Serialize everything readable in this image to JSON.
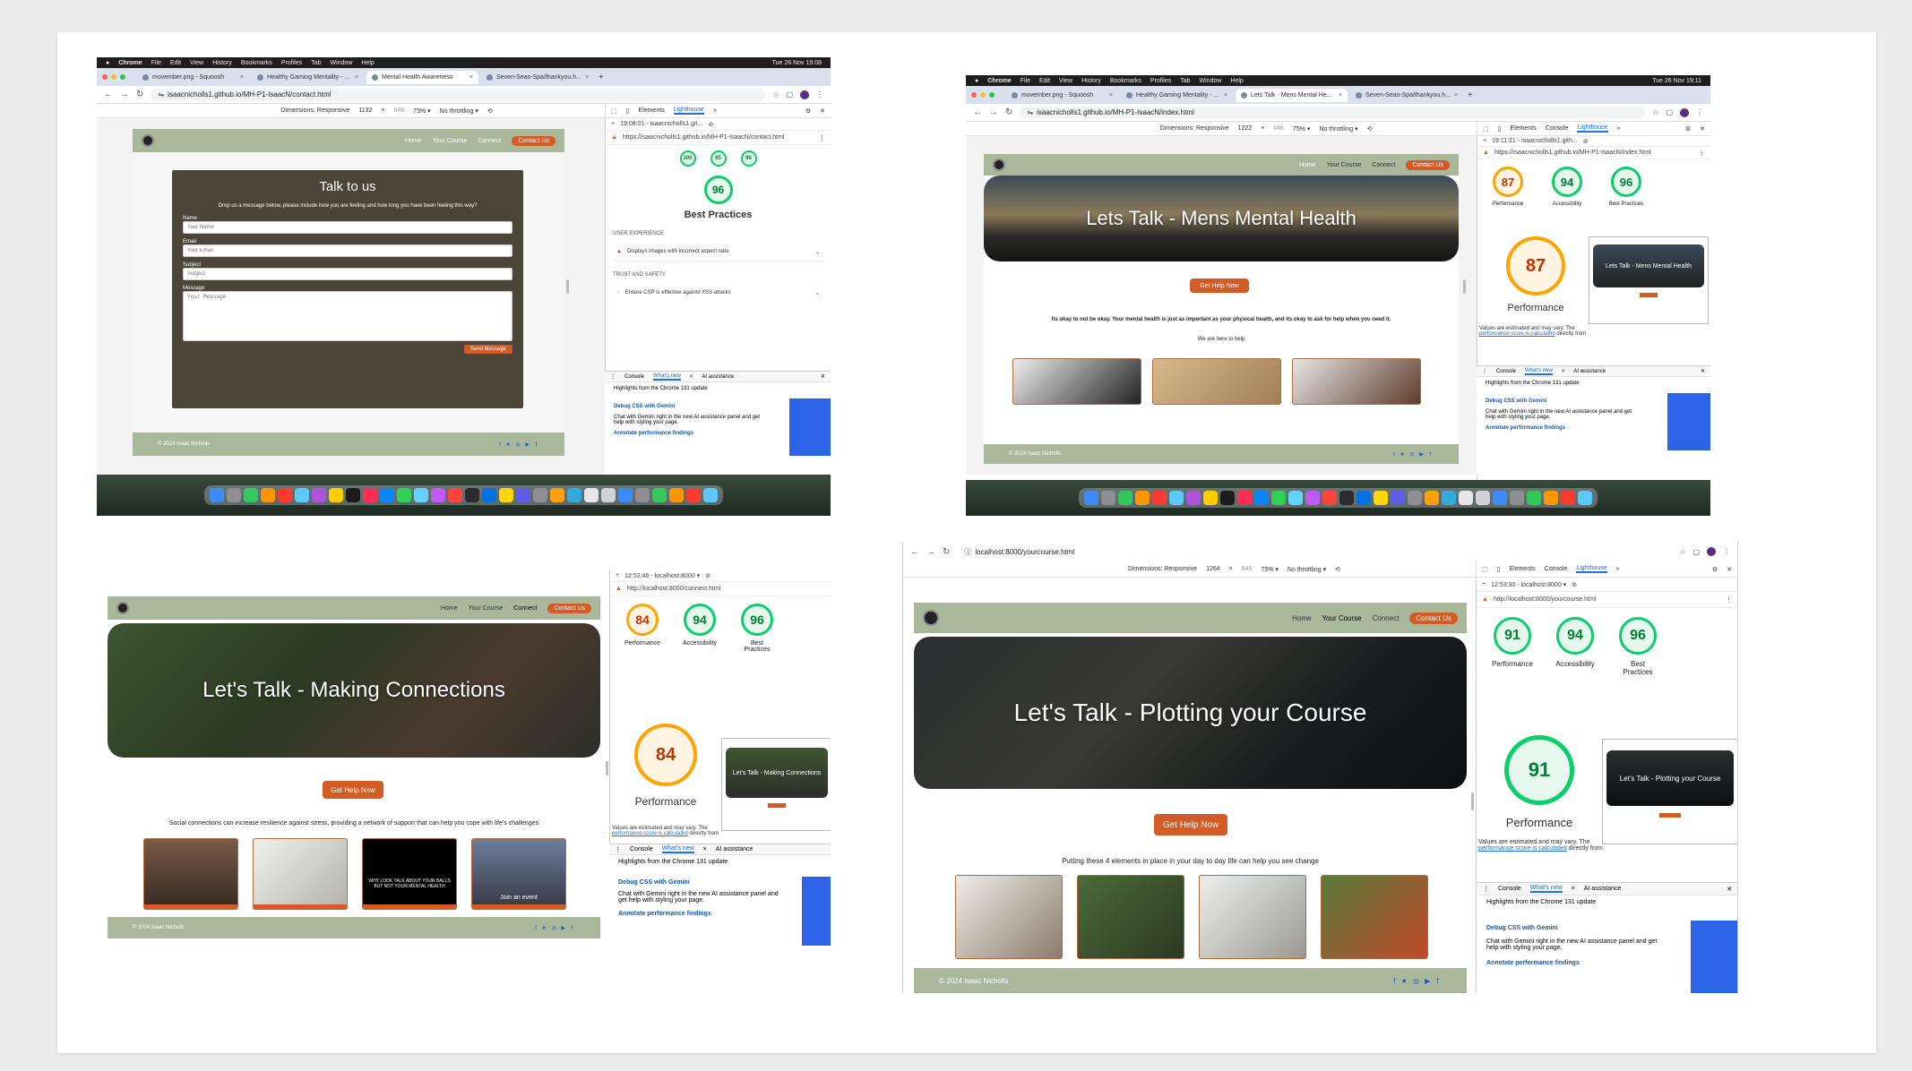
{
  "mac": {
    "apple": "",
    "app": "Chrome",
    "menus": [
      "File",
      "Edit",
      "View",
      "History",
      "Bookmarks",
      "Profiles",
      "Tab",
      "Window",
      "Help"
    ]
  },
  "shot1": {
    "clock": "Tue 26 Nov 19:08",
    "tabs": [
      "movember.png - Squoosh",
      "Healthy Gaming Mentality - ...",
      "Mental Health Awareness",
      "Seven-Seas-Spa/thankyou.h..."
    ],
    "url": "isaacnicholls1.github.io/MH-P1-IsaacN/contact.html",
    "dims": "Dimensions: Responsive",
    "w": "1132",
    "h": "646",
    "zoom": "75%",
    "throttle": "No throttling",
    "lh_time": "19:08:01 - isaacnicholls1.git...",
    "lh_url": "https://isaacnicholls1.github.io/MH-P1-IsaacN/contact.html",
    "mini_scores": [
      "100",
      "95",
      "96"
    ],
    "big_score": "96",
    "big_label": "Best Practices",
    "ux": "USER EXPERIENCE",
    "ux_item": "Displays images with incorrect aspect ratio",
    "trust": "TRUST AND SAFETY",
    "trust_item": "Ensure CSP is effective against XSS attacks",
    "form": {
      "title": "Talk to us",
      "intro": "Drop us a message below, please include how you are feeling and how long you have been feeling this way?",
      "name": "Name",
      "name_ph": "Your Name",
      "email": "Email",
      "email_ph": "Your Email",
      "subject": "Subject",
      "subject_ph": "Subject",
      "message": "Message",
      "message_ph": "Your Message",
      "send": "Send Message"
    }
  },
  "shot2": {
    "clock": "Tue 26 Nov 19:11",
    "tabs": [
      "movember.png - Squoosh",
      "Healthy Gaming Mentality - ...",
      "Lets Talk - Mens Mental He...",
      "Seven-Seas-Spa/thankyou.h..."
    ],
    "url": "isaacnicholls1.github.io/MH-P1-IsaacN/index.html",
    "w": "1222",
    "h": "646",
    "lh_time": "19:11:21 - isaacnicholls1.gith...",
    "lh_url": "https://isaacnicholls1.github.io/MH-P1-IsaacN/index.html",
    "scores": [
      {
        "v": "87",
        "l": "Performance"
      },
      {
        "v": "94",
        "l": "Accessibility"
      },
      {
        "v": "96",
        "l": "Best Practices"
      }
    ],
    "big": "87",
    "hero": "Lets Talk - Mens Mental Health",
    "tagline": "Its okay to not be okay. Your mental health is just as important as your physical health, and its okay to ask for help when you need it.",
    "sub": "We are here to help",
    "thumb": "Lets Talk - Mens Mental Health"
  },
  "shot3": {
    "lh_time": "12:52:46 - localhost:8000 ▾",
    "lh_url": "http://localhost:8000/connect.html",
    "scores": [
      {
        "v": "84",
        "l": "Performance"
      },
      {
        "v": "94",
        "l": "Accessibility"
      },
      {
        "v": "96",
        "l": "Best Practices"
      }
    ],
    "big": "84",
    "hero": "Let's Talk - Making Connections",
    "tagline": "Social connections can increase resilience against stress, providing a network of support that can help you cope with life's challenges",
    "thumb": "Let's Talk - Making Connections",
    "card3": "WHY LOOK TALK ABOUT YOUR BALLS BUT NOT YOUR MENTAL HEALTH",
    "card4": "Join an event"
  },
  "shot4": {
    "url": "localhost:8000/yourcourse.html",
    "w": "1264",
    "h": "646",
    "lh_time": "12:53:30 - localhost:8000 ▾",
    "lh_url": "http://localhost:8000/yourcourse.html",
    "scores": [
      {
        "v": "91",
        "l": "Performance"
      },
      {
        "v": "94",
        "l": "Accessibility"
      },
      {
        "v": "96",
        "l": "Best Practices"
      }
    ],
    "big": "91",
    "hero": "Let's Talk - Plotting your Course",
    "tagline": "Putting these 4 elements in place in your day to day life can help you see change",
    "thumb": "Let's Talk - Plotting your Course"
  },
  "common": {
    "nav": [
      "Home",
      "Your Course",
      "Connect"
    ],
    "contact": "Contact Us",
    "help": "Get Help Now",
    "footer": "© 2024 Isaac Nicholls",
    "social": "f ★ ◎ ▶ †",
    "dims": "Dimensions: Responsive",
    "zoom": "75% ▾",
    "throttle": "No throttling ▾",
    "dt_tabs": [
      "Elements",
      "Console",
      "Lighthouse"
    ],
    "perf_label": "Performance",
    "values_note": "Values are estimated and may vary. The",
    "calc_link": "performance score is calculated",
    "calc_rest": "directly from",
    "console": "Console",
    "whats_new": "What's new",
    "ai": "AI assistance",
    "highlights": "Highlights from the Chrome 131 update",
    "debug": "Debug CSS with Gemini",
    "debug_desc": "Chat with Gemini right in the new AI assistance panel and get help with styling your page.",
    "annotate": "Annotate performance findings",
    "btn_label": "Get Help Now",
    "we_help": "We are here to help"
  },
  "colors": {
    "accent": "#d35b25",
    "site_green": "#a9b89b",
    "good": "#0cce6b",
    "average": "#ffa400"
  }
}
